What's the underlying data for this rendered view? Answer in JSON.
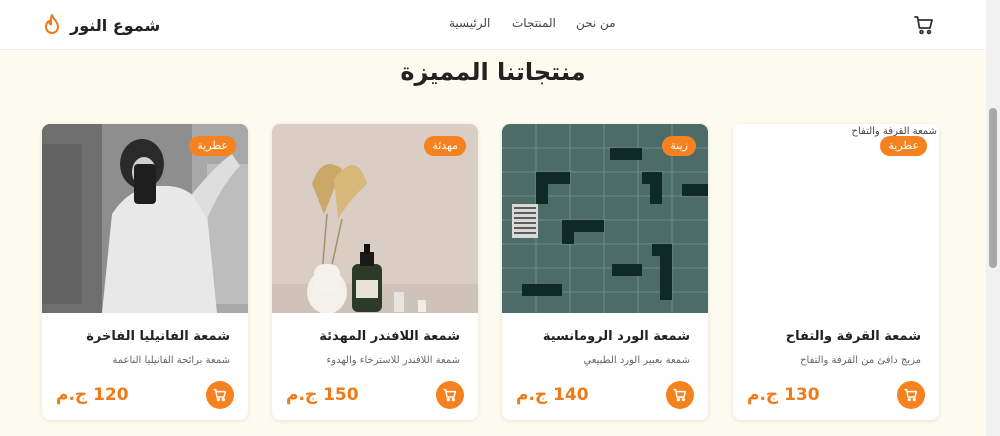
{
  "brand": {
    "name": "شموع النور",
    "icon": "flame-icon"
  },
  "nav": {
    "items": [
      "الرئيسية",
      "المنتجات",
      "من نحن"
    ]
  },
  "header": {
    "cart_icon": "cart-icon"
  },
  "section": {
    "title": "منتجاتنا المميزة"
  },
  "products": [
    {
      "title": "شمعة الفانيليا الفاخرة",
      "description": "شمعة برائحة الفانيليا الناعمة",
      "price": "120 ج.م",
      "badge": "عطرية"
    },
    {
      "title": "شمعة اللافندر المهدئة",
      "description": "شمعة اللافندر للاسترخاء والهدوء",
      "price": "150 ج.م",
      "badge": "مهدئة"
    },
    {
      "title": "شمعة الورد الرومانسية",
      "description": "شمعة بعبير الورد الطبيعي",
      "price": "140 ج.م",
      "badge": "زينة"
    },
    {
      "title": "شمعة القرفة والتفاح",
      "description": "مزيج دافئ من القرفة والتفاح",
      "price": "130 ج.م",
      "badge": "عطرية",
      "image_alt": "شمعة القرفة والتفاح"
    }
  ],
  "colors": {
    "accent": "#f5821f",
    "price": "#f07a18",
    "background": "#fdfaf0"
  }
}
